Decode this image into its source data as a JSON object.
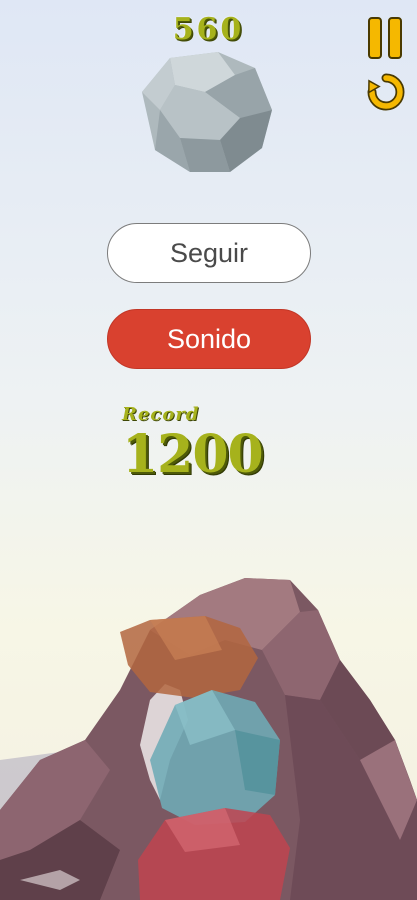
{
  "hud": {
    "score": "560",
    "pause_icon": "pause-icon",
    "restart_icon": "restart-icon"
  },
  "menu": {
    "continue_label": "Seguir",
    "sound_label": "Sonido"
  },
  "record": {
    "label": "Record",
    "value": "1200"
  },
  "colors": {
    "score_green": "#a6b21c",
    "button_red": "#d9412f",
    "icon_yellow": "#f5b800"
  }
}
